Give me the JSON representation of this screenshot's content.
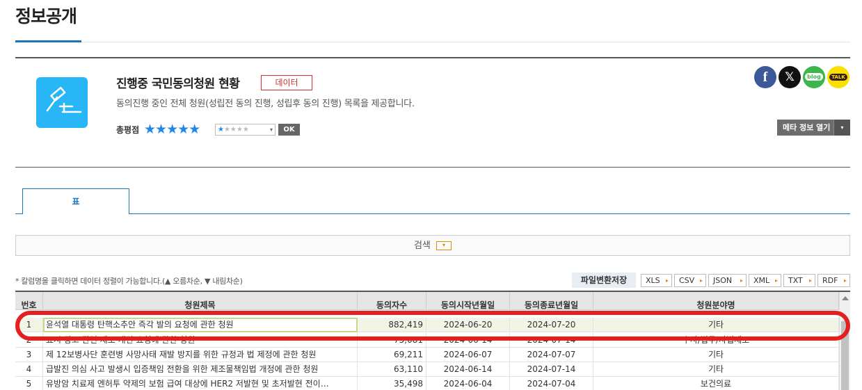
{
  "page_title": "정보공개",
  "dataset": {
    "title": "진행중 국민동의청원 현황",
    "badge": "데이터",
    "description": "동의진행 중인 전체 청원(성립전 동의 진행, 성립후 동의 진행) 목록을 제공합니다.",
    "rating_label": "총평점",
    "rating_stars": "★★★★★",
    "rate_select": {
      "filled": "★",
      "empty": "★★★★",
      "arrow": "▾"
    },
    "ok_label": "OK",
    "meta_button": "메타 정보 열기",
    "meta_arrow": "▾",
    "logo_icon": "gavel-icon"
  },
  "social": {
    "facebook": "f",
    "x": "𝕏",
    "blog": "blog",
    "talk": "TALK"
  },
  "tabs": [
    {
      "label": "표"
    }
  ],
  "search": {
    "label": "검색",
    "toggle": "▾"
  },
  "sort_hint": "* 칼럼명을 클릭하면 데이터 정렬이 가능합니다.(▲ 오름차순, ▼ 내림차순)",
  "file_convert_label": "파일변환저장",
  "formats": [
    "XLS",
    "CSV",
    "JSON",
    "XML",
    "TXT",
    "RDF"
  ],
  "format_arrow": "▸",
  "table": {
    "headers": [
      "번호",
      "청원제목",
      "동의자수",
      "동의시작년월일",
      "동의종료년월일",
      "청원분야명"
    ],
    "rows": [
      {
        "num": "1",
        "title": "윤석열 대통령 탄핵소추안 즉각 발의 요청에 관한 청원",
        "count": "882,419",
        "start": "2024-06-20",
        "end": "2024-07-20",
        "field": "기타"
      },
      {
        "num": "2",
        "title": "표시·광고 관련 제도 개선 요청에 관한 청원",
        "count": "75,081",
        "start": "2024-06-14",
        "end": "2024-07-14",
        "field": "수사/법무/사법제도"
      },
      {
        "num": "3",
        "title": "제 12보병사단 훈련병 사망사태 재발 방지를 위한 규정과 법 제정에 관한 청원",
        "count": "69,211",
        "start": "2024-06-07",
        "end": "2024-07-07",
        "field": "기타"
      },
      {
        "num": "4",
        "title": "급발진 의심 사고 발생시 입증책임 전환을 위한 제조물책임법 개정에 관한 청원",
        "count": "63,110",
        "start": "2024-06-14",
        "end": "2024-07-14",
        "field": "기타"
      },
      {
        "num": "5",
        "title": "유방암 치료제 엔허투 약제의 보험 급여 대상에 HER2 저발현 및 초저발현 전이…",
        "count": "35,498",
        "start": "2024-06-04",
        "end": "2024-07-04",
        "field": "보건의료"
      }
    ]
  }
}
